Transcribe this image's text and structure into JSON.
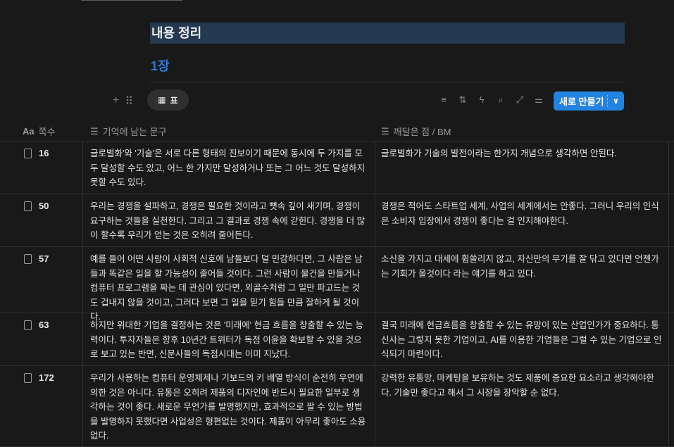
{
  "page": {
    "title": "내용 정리",
    "chapter": "1장"
  },
  "toolbar": {
    "view_label": "표",
    "new_label": "새로 만들기"
  },
  "columns": {
    "page": "쪽수",
    "quote": "기억에 남는 문구",
    "insight": "깨달은 점 / BM"
  },
  "rows": [
    {
      "page": "16",
      "quote": "글로벌화'와 '기술'은 서로 다른 형태의 진보이기 때문에 동시에 두 가지를 모두 달성할 수도 있고, 어느 한 가지만 달성하거나 또는 그 어느 것도 달성하지 못할 수도 있다.",
      "insight": "글로벌화가 기술의 발전이라는 한가지 개념으로 생각하면 안된다."
    },
    {
      "page": "50",
      "quote": "우리는 경쟁을 설파하고, 경쟁은 필요한 것이라고 뼛속 깊이 새기며, 경쟁이 요구하는 것들을 실천한다. 그리고 그 결과로 경쟁 속에 갇힌다. 경쟁을 더 많이 할수록 우리가 얻는 것은 오히려 줄어든다.",
      "insight": "경쟁은 적어도 스타트업 세계, 사업의 세계에서는 안좋다. 그러니 우리의 인식은 소비자 입장에서 경쟁이 좋다는 걸 인지해야한다."
    },
    {
      "page": "57",
      "quote": "예를 들어 어떤 사람이 사회적 신호에 남들보다 덜 민감하다면, 그 사람은 남들과 똑같은 일을 할 가능성이 줄어들 것이다. 그런 사람이 물건을 만들거나 컴퓨터 프로그램을 짜는 데 관심이 있다면, 외골수처럼 그 일만 파고드는 것도 겁내지 않을 것이고, 그러다 보면 그 일을 믿기 힘들 만큼 잘하게 될 것이다.",
      "insight": "소신을 가지고 대세에 휩쓸리지 않고, 자신만의 무기를 잘 닦고 있다면 언젠가는 기회가 올것이다 라는 얘기를 하고 있다."
    },
    {
      "page": "63",
      "quote": "하지만 위대한 기업을 결정하는 것은 '미래에' 현금 흐름을 창출할 수 있는 능력이다. 투자자들은 향후 10년간 트위터가 독점 이윤을 확보할 수 있을 것으로 보고 있는 반면, 신문사들의 독점시대는 이미 지났다.",
      "insight": "결국 미래에 현금흐름을 창출할 수 있는 유망이 있는 산업인가가 중요하다. 통신사는 그렇지 못한 기업이고, AI를 이용한 기업들은 그럴 수 있는 기업으로 인식되기 마련이다."
    },
    {
      "page": "172",
      "quote": "우리가 사용하는 컴퓨터 운영체제나 기보드의 키 배열 방식이 순전히 우연에 의한 것은 아니다. 유통은 오히려 제품의 디자인에 반드시 필요한 일부로 생각하는 것이 좋다. 새로운 무언가를 발명했지만, 효과적으로 팔 수 있는 방법을 발명하지 못했다면 사업성은 형편없는 것이다. 제품이 아무리 좋아도 소용없다.",
      "insight": "강력한 유통망, 마케팅을 보유하는 것도 제품에 중요한 요소라고 생각해야한다. 기술만 좋다고 해서 그 시장을 장악할 순 없다."
    }
  ]
}
